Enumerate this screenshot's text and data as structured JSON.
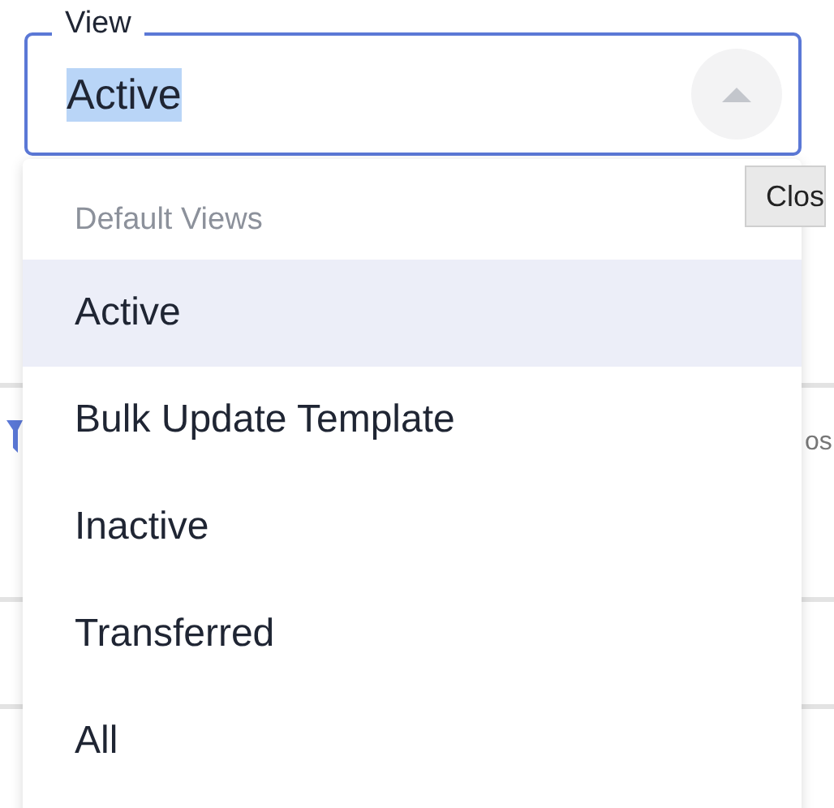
{
  "field": {
    "label": "View",
    "value": "Active",
    "expanded": true
  },
  "menu": {
    "group": "Default Views",
    "items": [
      {
        "label": "Active",
        "selected": true
      },
      {
        "label": "Bulk Update Template",
        "selected": false
      },
      {
        "label": "Inactive",
        "selected": false
      },
      {
        "label": "Transferred",
        "selected": false
      },
      {
        "label": "All",
        "selected": false
      }
    ]
  },
  "tooltip": {
    "text": "Clos"
  },
  "table": {
    "column_text": "os"
  }
}
